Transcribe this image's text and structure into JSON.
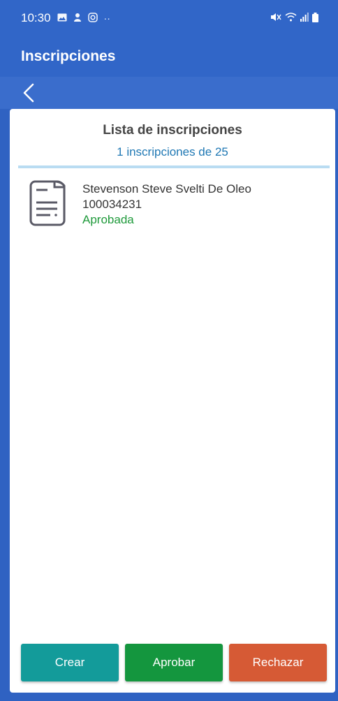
{
  "status_bar": {
    "time": "10:30",
    "left_icons": [
      "gallery-icon",
      "person-icon",
      "instagram-icon",
      "more-dots-icon"
    ],
    "right_icons": [
      "mute-icon",
      "wifi-icon",
      "signal-icon",
      "battery-icon"
    ]
  },
  "app_bar": {
    "title": "Inscripciones"
  },
  "list": {
    "title": "Lista de inscripciones",
    "count_text": "1 inscripciones de 25",
    "items": [
      {
        "name": "Stevenson Steve Svelti De Oleo",
        "id": "100034231",
        "status": "Aprobada",
        "icon": "document-icon"
      }
    ]
  },
  "actions": {
    "create_label": "Crear",
    "approve_label": "Aprobar",
    "reject_label": "Rechazar"
  },
  "colors": {
    "primary": "#3166c8",
    "create": "#139b9a",
    "approve": "#14963e",
    "reject": "#d65a35",
    "status_approved": "#1f9a3b",
    "count_text": "#1f78b4"
  }
}
